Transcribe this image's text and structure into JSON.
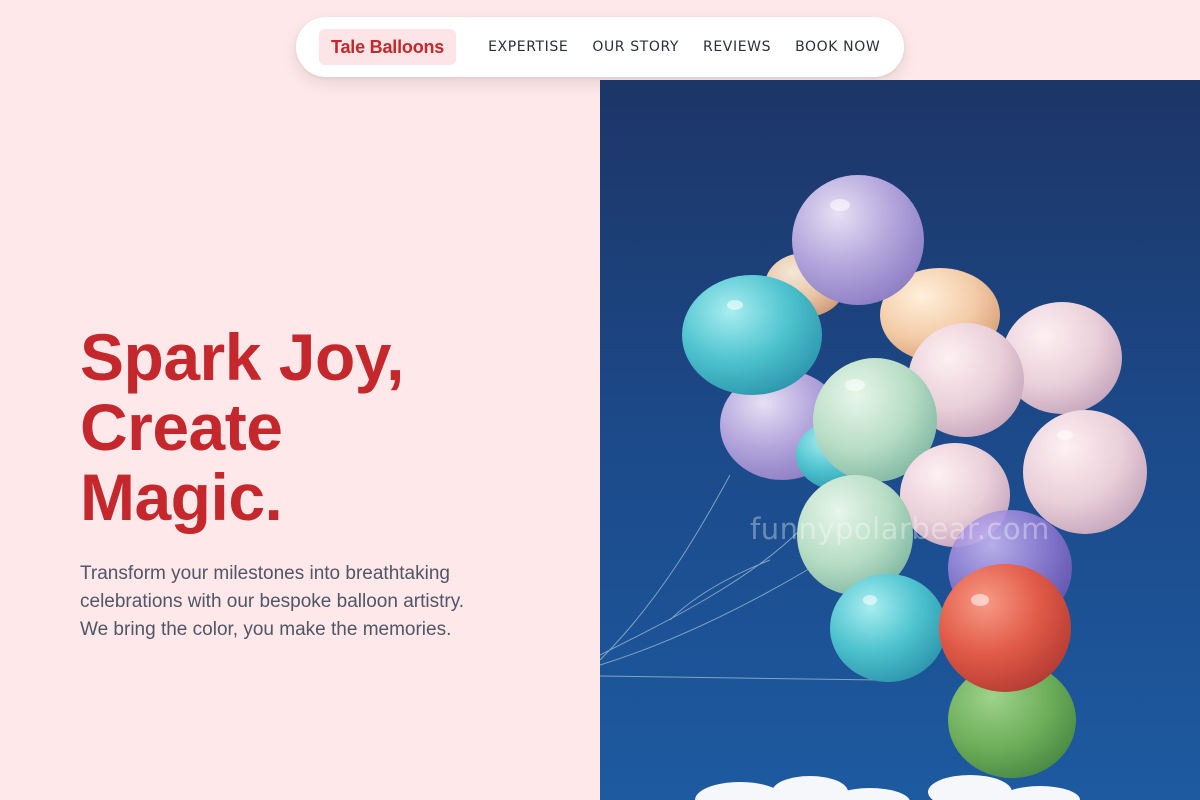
{
  "nav": {
    "brand": "Tale Balloons",
    "links": [
      "EXPERTISE",
      "OUR STORY",
      "REVIEWS",
      "BOOK NOW"
    ]
  },
  "hero": {
    "title_lines": [
      "Spark Joy,",
      "Create",
      "Magic."
    ],
    "subtitle_lines": [
      "Transform your milestones into breathtaking",
      "celebrations with our bespoke balloon artistry.",
      "We bring the color, you make the memories."
    ]
  },
  "image": {
    "watermark": "funnypolarbear.com",
    "subject": "balloons-against-blue-sky"
  },
  "colors": {
    "page_bg": "#ffe8ea",
    "accent": "#c5282c",
    "brand_bg": "#fde4e6",
    "body_text": "#4f5666",
    "nav_text": "#2b2f3a"
  }
}
